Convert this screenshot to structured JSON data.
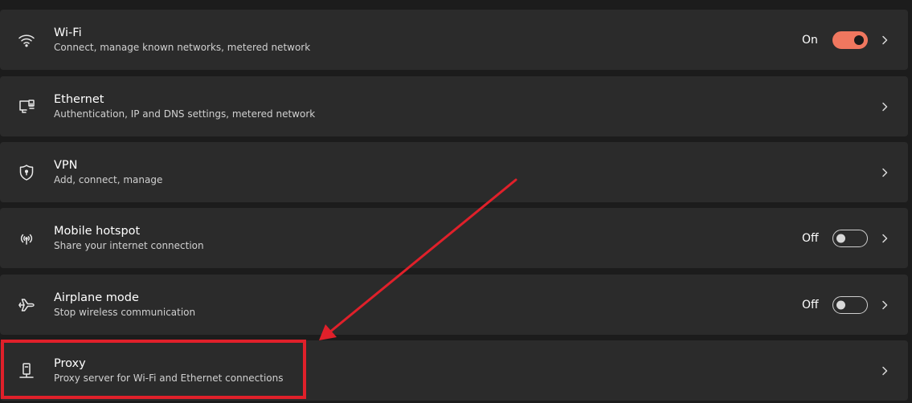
{
  "settings": {
    "rows": [
      {
        "id": "wifi",
        "title": "Wi-Fi",
        "subtitle": "Connect, manage known networks, metered network",
        "icon": "wifi-icon",
        "toggle": "On"
      },
      {
        "id": "ethernet",
        "title": "Ethernet",
        "subtitle": "Authentication, IP and DNS settings, metered network",
        "icon": "ethernet-icon"
      },
      {
        "id": "vpn",
        "title": "VPN",
        "subtitle": "Add, connect, manage",
        "icon": "shield-icon"
      },
      {
        "id": "hotspot",
        "title": "Mobile hotspot",
        "subtitle": "Share your internet connection",
        "icon": "hotspot-icon",
        "toggle": "Off"
      },
      {
        "id": "airplane",
        "title": "Airplane mode",
        "subtitle": "Stop wireless communication",
        "icon": "airplane-icon",
        "toggle": "Off"
      },
      {
        "id": "proxy",
        "title": "Proxy",
        "subtitle": "Proxy server for Wi-Fi and Ethernet connections",
        "icon": "proxy-icon"
      }
    ]
  },
  "colors": {
    "background": "#1c1c1c",
    "row": "#2b2b2b",
    "accent": "#f0775f",
    "annotation": "#e0202a"
  }
}
